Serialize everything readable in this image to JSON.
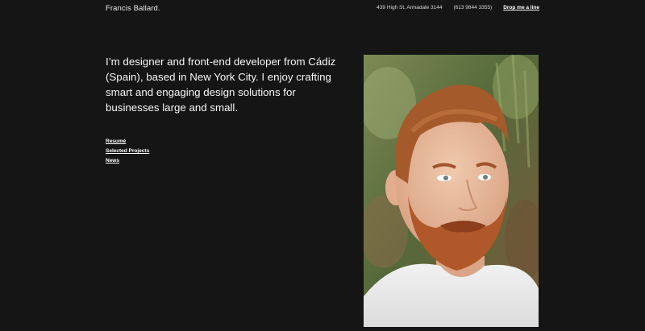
{
  "header": {
    "site_name": "Francis Ballard.",
    "address": "439 High St, Armadale 3144",
    "phone": "(613 9844 3355)",
    "cta": "Drop me a line"
  },
  "intro": {
    "text": "I’m designer and front-end developer from Cádiz (Spain), based in New York City. I enjoy crafting smart and engaging design solutions for businesses large and small."
  },
  "links": [
    {
      "label": "Resumé"
    },
    {
      "label": "Selected Projects"
    },
    {
      "label": "News"
    }
  ],
  "colors": {
    "background": "#151515",
    "text": "#f7f7f7"
  }
}
